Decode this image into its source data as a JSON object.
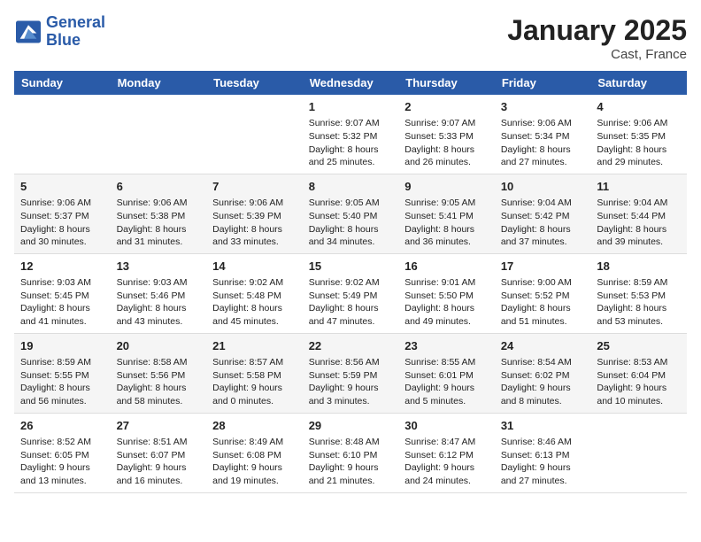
{
  "header": {
    "logo_line1": "General",
    "logo_line2": "Blue",
    "month": "January 2025",
    "location": "Cast, France"
  },
  "days_of_week": [
    "Sunday",
    "Monday",
    "Tuesday",
    "Wednesday",
    "Thursday",
    "Friday",
    "Saturday"
  ],
  "weeks": [
    [
      {
        "day": "",
        "content": ""
      },
      {
        "day": "",
        "content": ""
      },
      {
        "day": "",
        "content": ""
      },
      {
        "day": "1",
        "content": "Sunrise: 9:07 AM\nSunset: 5:32 PM\nDaylight: 8 hours and 25 minutes."
      },
      {
        "day": "2",
        "content": "Sunrise: 9:07 AM\nSunset: 5:33 PM\nDaylight: 8 hours and 26 minutes."
      },
      {
        "day": "3",
        "content": "Sunrise: 9:06 AM\nSunset: 5:34 PM\nDaylight: 8 hours and 27 minutes."
      },
      {
        "day": "4",
        "content": "Sunrise: 9:06 AM\nSunset: 5:35 PM\nDaylight: 8 hours and 29 minutes."
      }
    ],
    [
      {
        "day": "5",
        "content": "Sunrise: 9:06 AM\nSunset: 5:37 PM\nDaylight: 8 hours and 30 minutes."
      },
      {
        "day": "6",
        "content": "Sunrise: 9:06 AM\nSunset: 5:38 PM\nDaylight: 8 hours and 31 minutes."
      },
      {
        "day": "7",
        "content": "Sunrise: 9:06 AM\nSunset: 5:39 PM\nDaylight: 8 hours and 33 minutes."
      },
      {
        "day": "8",
        "content": "Sunrise: 9:05 AM\nSunset: 5:40 PM\nDaylight: 8 hours and 34 minutes."
      },
      {
        "day": "9",
        "content": "Sunrise: 9:05 AM\nSunset: 5:41 PM\nDaylight: 8 hours and 36 minutes."
      },
      {
        "day": "10",
        "content": "Sunrise: 9:04 AM\nSunset: 5:42 PM\nDaylight: 8 hours and 37 minutes."
      },
      {
        "day": "11",
        "content": "Sunrise: 9:04 AM\nSunset: 5:44 PM\nDaylight: 8 hours and 39 minutes."
      }
    ],
    [
      {
        "day": "12",
        "content": "Sunrise: 9:03 AM\nSunset: 5:45 PM\nDaylight: 8 hours and 41 minutes."
      },
      {
        "day": "13",
        "content": "Sunrise: 9:03 AM\nSunset: 5:46 PM\nDaylight: 8 hours and 43 minutes."
      },
      {
        "day": "14",
        "content": "Sunrise: 9:02 AM\nSunset: 5:48 PM\nDaylight: 8 hours and 45 minutes."
      },
      {
        "day": "15",
        "content": "Sunrise: 9:02 AM\nSunset: 5:49 PM\nDaylight: 8 hours and 47 minutes."
      },
      {
        "day": "16",
        "content": "Sunrise: 9:01 AM\nSunset: 5:50 PM\nDaylight: 8 hours and 49 minutes."
      },
      {
        "day": "17",
        "content": "Sunrise: 9:00 AM\nSunset: 5:52 PM\nDaylight: 8 hours and 51 minutes."
      },
      {
        "day": "18",
        "content": "Sunrise: 8:59 AM\nSunset: 5:53 PM\nDaylight: 8 hours and 53 minutes."
      }
    ],
    [
      {
        "day": "19",
        "content": "Sunrise: 8:59 AM\nSunset: 5:55 PM\nDaylight: 8 hours and 56 minutes."
      },
      {
        "day": "20",
        "content": "Sunrise: 8:58 AM\nSunset: 5:56 PM\nDaylight: 8 hours and 58 minutes."
      },
      {
        "day": "21",
        "content": "Sunrise: 8:57 AM\nSunset: 5:58 PM\nDaylight: 9 hours and 0 minutes."
      },
      {
        "day": "22",
        "content": "Sunrise: 8:56 AM\nSunset: 5:59 PM\nDaylight: 9 hours and 3 minutes."
      },
      {
        "day": "23",
        "content": "Sunrise: 8:55 AM\nSunset: 6:01 PM\nDaylight: 9 hours and 5 minutes."
      },
      {
        "day": "24",
        "content": "Sunrise: 8:54 AM\nSunset: 6:02 PM\nDaylight: 9 hours and 8 minutes."
      },
      {
        "day": "25",
        "content": "Sunrise: 8:53 AM\nSunset: 6:04 PM\nDaylight: 9 hours and 10 minutes."
      }
    ],
    [
      {
        "day": "26",
        "content": "Sunrise: 8:52 AM\nSunset: 6:05 PM\nDaylight: 9 hours and 13 minutes."
      },
      {
        "day": "27",
        "content": "Sunrise: 8:51 AM\nSunset: 6:07 PM\nDaylight: 9 hours and 16 minutes."
      },
      {
        "day": "28",
        "content": "Sunrise: 8:49 AM\nSunset: 6:08 PM\nDaylight: 9 hours and 19 minutes."
      },
      {
        "day": "29",
        "content": "Sunrise: 8:48 AM\nSunset: 6:10 PM\nDaylight: 9 hours and 21 minutes."
      },
      {
        "day": "30",
        "content": "Sunrise: 8:47 AM\nSunset: 6:12 PM\nDaylight: 9 hours and 24 minutes."
      },
      {
        "day": "31",
        "content": "Sunrise: 8:46 AM\nSunset: 6:13 PM\nDaylight: 9 hours and 27 minutes."
      },
      {
        "day": "",
        "content": ""
      }
    ]
  ]
}
